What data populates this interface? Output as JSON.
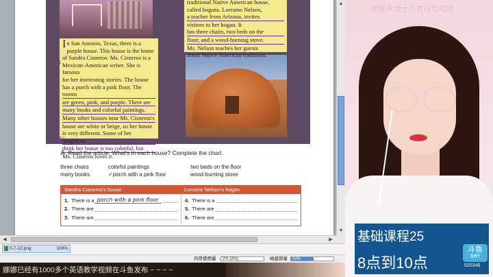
{
  "article": {
    "right_text": [
      "traditional Native American house,",
      "called hogans. Lorraine Nelson,",
      "a teacher from Arizona, invites",
      "visitors to her hogan. It",
      "has three chairs, two beds on the",
      "floor, and a wood-burning stove.",
      "Ms. Nelson teaches her guests",
      "about Native American traditions."
    ],
    "left_dropcap": "I",
    "left_text": [
      "n San Antonio, Texas, there is a",
      "purple house. This house is the home",
      "of Sandra Cisneros. Ms. Cisneros is a",
      "Mexican-American writer. She is famous",
      "for her interesting stories. The house",
      "has a porch with a pink floor. The rooms",
      "are green, pink, and purple. There are",
      "many books and colorful paintings.",
      "Many other houses near Ms. Cisneros's",
      "house are white or beige, so her house",
      "is very different. Some of her neighbors",
      "think her house is too colorful, but",
      "Ms. Cisneros loves it."
    ],
    "ink_note_1": "as",
    "ink_note_2": "(tā)"
  },
  "exercise": {
    "letter": "A",
    "instruction": "Read the article. What's in each house? Complete the chart.",
    "wordbank": {
      "col1": [
        "three chairs",
        "many books"
      ],
      "col2": [
        "colorful paintings",
        "✓porch with a pink floor"
      ],
      "col3": [
        "two beds on the floor",
        "wood-burning stove"
      ]
    },
    "chart": {
      "header_left": "Sandra Cisneros's house",
      "header_right": "Lorraine Nelson's hogan",
      "left_rows": [
        {
          "num": "1.",
          "text": "There is a",
          "answer": "porch with a pink floor"
        },
        {
          "num": "2.",
          "text": "There are",
          "answer": ""
        },
        {
          "num": "3.",
          "text": "There are",
          "answer": ""
        }
      ],
      "right_rows": [
        {
          "num": "4.",
          "text": "There is a",
          "answer": ""
        },
        {
          "num": "5.",
          "text": "There are",
          "answer": ""
        },
        {
          "num": "6.",
          "text": "There are",
          "answer": ""
        }
      ]
    }
  },
  "viewer": {
    "thumbnail_filename": "0-7-12.png",
    "thumbnail_zoom": "100%",
    "memory_label": "内存使用量",
    "memory_value": "2% (2%)",
    "disk_label": "磁盘容量",
    "disk_value": "53%",
    "disk_fraction": 0.53
  },
  "ticker": {
    "text": "娜娜已经有1000多个英语教学视频在斗鱼发布 ~ ~ ~ ~"
  },
  "stream": {
    "title": "娜娜永远十八岁哇哈哈哈",
    "course_line1": "基础课程25",
    "course_line2": "8点到10点",
    "platform_logo": "斗鱼",
    "platform_sub": "直播号",
    "room_id": "520346"
  },
  "icons": {
    "up": "▲",
    "down": "▼",
    "left": "◀",
    "right": "▶"
  },
  "colors": {
    "accent_blue": "#13558e",
    "chart_header": "#d4563a",
    "ink": "#7a2f9c",
    "textbox": "#f6ea8e"
  }
}
